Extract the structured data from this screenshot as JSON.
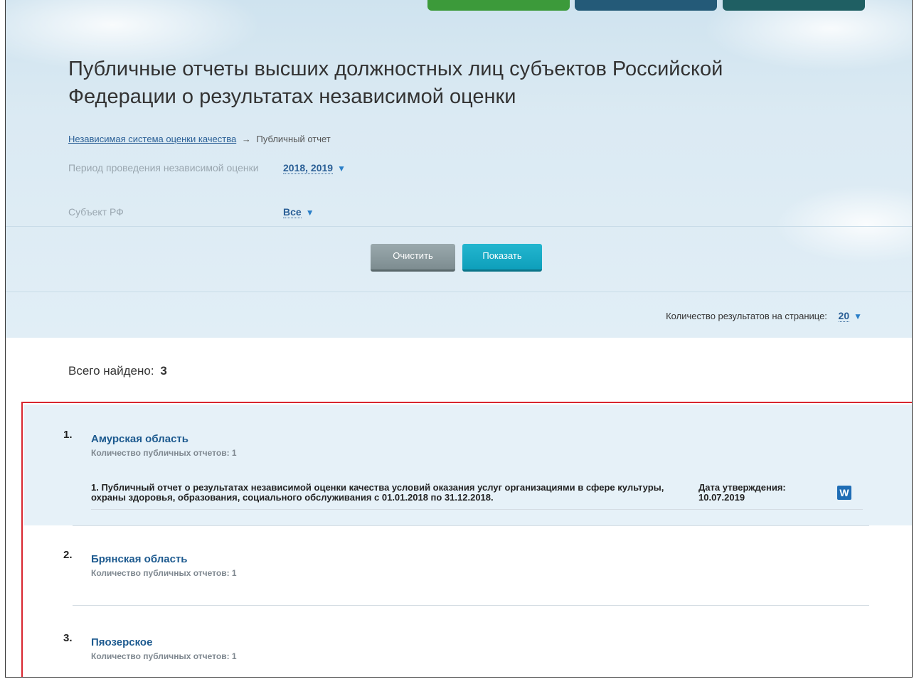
{
  "page": {
    "title": "Публичные отчеты высших должностных лиц субъектов Российской Федерации о результатах независимой оценки"
  },
  "breadcrumb": {
    "link": "Независимая система оценки качества",
    "separator": "→",
    "current": "Публичный отчет"
  },
  "filters": {
    "period_label": "Период проведения независимой оценки",
    "period_value": "2018, 2019",
    "subject_label": "Субъект РФ",
    "subject_value": "Все"
  },
  "buttons": {
    "clear": "Очистить",
    "show": "Показать"
  },
  "per_page": {
    "label": "Количество результатов на странице:",
    "value": "20"
  },
  "results": {
    "total_label": "Всего найдено:",
    "total_value": "3",
    "items": [
      {
        "num": "1.",
        "title": "Амурская область",
        "count": "Количество публичных отчетов: 1",
        "report": {
          "text": "1. Публичный отчет о результатах независимой оценки качества условий оказания услуг организациями в сфере культуры, охраны здоровья, образования, социального обслуживания с 01.01.2018 по 31.12.2018.",
          "date_label": "Дата утверждения:",
          "date_value": "10.07.2019",
          "file_icon": "W"
        }
      },
      {
        "num": "2.",
        "title": "Брянская область",
        "count": "Количество публичных отчетов: 1"
      },
      {
        "num": "3.",
        "title": "Пяозерское",
        "count": "Количество публичных отчетов: 1"
      }
    ]
  },
  "colors": {
    "link": "#2a5f96",
    "highlight_border": "#d8262f",
    "show_button": "#0e9fbb",
    "clear_button": "#7d8c90"
  }
}
